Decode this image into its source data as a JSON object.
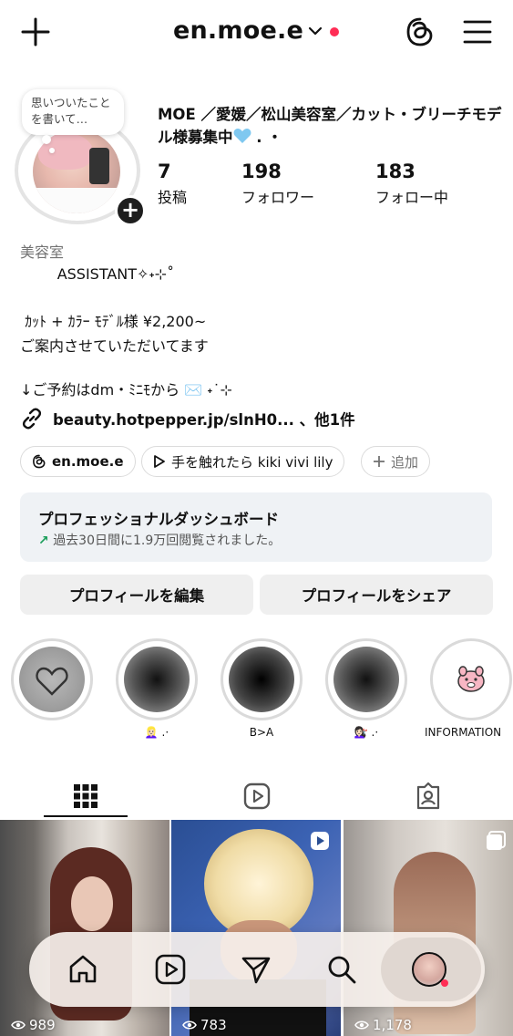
{
  "header": {
    "username": "en.moe.e"
  },
  "profile": {
    "note": "思いついたことを書いて…",
    "display_name": "MOE ／愛媛／松山美容室／カット・ブリーチモデル様募集中",
    "display_name_suffix": " . ・",
    "stats": [
      {
        "value": "7",
        "label": "投稿"
      },
      {
        "value": "198",
        "label": "フォロワー"
      },
      {
        "value": "183",
        "label": "フォロー中"
      }
    ],
    "category": "美容室",
    "bio_lines": [
      "        ASSISTANT✧˖⊹˚",
      "",
      " ｶｯﾄ + ｶﾗｰ ﾓﾃﾞﾙ様 ¥2,200~",
      "ご案内させていただいてます",
      "",
      "↓ご予約はdm・ﾐﾆﾓから ✉️ ˖˙⊹"
    ],
    "link_text": "beauty.hotpepper.jp/slnH0... 、他1件"
  },
  "chips": {
    "threads": "en.moe.e",
    "music": "手を触れたら kiki vivi lily",
    "add": "追加"
  },
  "dashboard": {
    "title": "プロフェッショナルダッシュボード",
    "subtitle": "過去30日間に1.9万回閲覧されました。"
  },
  "actions": {
    "edit": "プロフィールを編集",
    "share": "プロフィールをシェア"
  },
  "highlights": [
    {
      "label": ""
    },
    {
      "label": "👱🏻‍♀️ .·"
    },
    {
      "label": "B>A"
    },
    {
      "label": "💇🏻‍♀️ .·"
    },
    {
      "label": "INFORMATION"
    }
  ],
  "grid": [
    {
      "views": "989"
    },
    {
      "views": "783"
    },
    {
      "views": "1,178"
    }
  ],
  "icons": {
    "create": "plus-icon",
    "threads": "threads-icon",
    "menu": "hamburger-menu-icon",
    "link": "link-icon",
    "reels": "reels-icon",
    "tagged": "tagged-icon",
    "home": "home-icon",
    "send": "send-icon",
    "search": "search-icon"
  },
  "colors": {
    "notification": "#ff2d55",
    "dashboard_bg": "#eff2f5",
    "button_bg": "#efefef",
    "growth_arrow": "#1a9e5a"
  }
}
